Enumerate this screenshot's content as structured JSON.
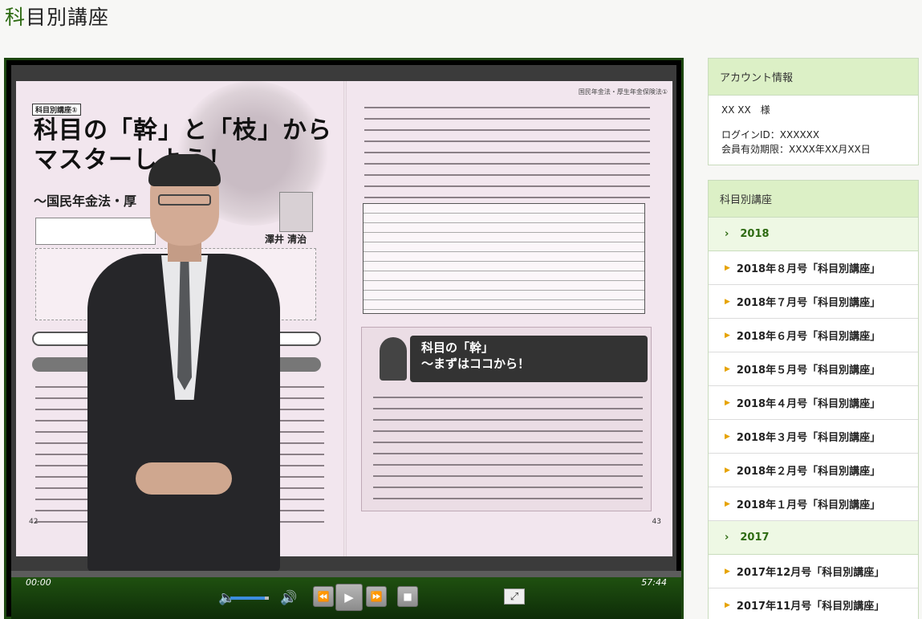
{
  "page": {
    "title_first": "科",
    "title_rest": "目別講座"
  },
  "player": {
    "current_time": "00:00",
    "duration": "57:44",
    "volume_fraction": 0.9,
    "progress_fraction": 0.0,
    "accent_color": "#1d4710",
    "icons": {
      "volume": "volume-icon",
      "volume_max": "volume-max-icon",
      "rewind": "rewind-icon",
      "play": "play-icon",
      "fast_forward": "fast-forward-icon",
      "stop": "stop-icon",
      "fullscreen": "fullscreen-icon"
    }
  },
  "slide": {
    "series_tag": "科目別講座①",
    "headline_line1": "科目の「幹」と「枝」から",
    "headline_line2": "マスターしよう！",
    "subhead": "～国民年金法・厚",
    "author": "澤井 清治",
    "page_left": "42",
    "page_right": "43",
    "running_head": "国民年金法・厚生年金保険法①",
    "section_banner_line1": "科目の「幹」",
    "section_banner_line2": "～まずはココから！"
  },
  "sidebar": {
    "account": {
      "heading": "アカウント情報",
      "name": "XX XX　様",
      "login_id": "ログインID：XXXXXX",
      "expiry": "会員有効期限：XXXX年XX月XX日"
    },
    "courses": {
      "heading": "科目別講座",
      "years": [
        {
          "label": "2018",
          "issues": [
            "2018年８月号「科目別講座」",
            "2018年７月号「科目別講座」",
            "2018年６月号「科目別講座」",
            "2018年５月号「科目別講座」",
            "2018年４月号「科目別講座」",
            "2018年３月号「科目別講座」",
            "2018年２月号「科目別講座」",
            "2018年１月号「科目別講座」"
          ]
        },
        {
          "label": "2017",
          "issues": [
            "2017年12月号「科目別講座」",
            "2017年11月号「科目別講座」"
          ]
        }
      ]
    },
    "colors": {
      "header_bg": "#dcf0c6",
      "year_text": "#2e6b12",
      "bullet": "#e6a300"
    }
  }
}
